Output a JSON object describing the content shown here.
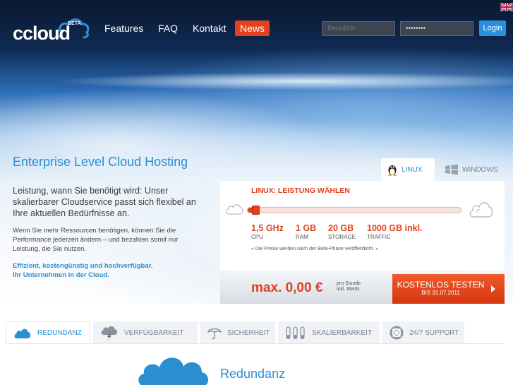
{
  "brand": {
    "logo_text": "ccloud",
    "logo_badge": "BETA"
  },
  "nav": {
    "items": [
      {
        "label": "Features"
      },
      {
        "label": "FAQ"
      },
      {
        "label": "Kontakt"
      },
      {
        "label": "News"
      }
    ]
  },
  "login": {
    "user_placeholder": "Benutzer",
    "password_value": "••••••••",
    "button_label": "Login"
  },
  "hero": {
    "title": "Enterprise Level Cloud Hosting",
    "lead": "Leistung, wann Sie benötigt wird: Unser skalierbarer Cloudservice passt sich flexibel an Ihre aktuellen Bedürfnisse an.",
    "body": "Wenn Sie mehr Ressourcen benötigen, können Sie die Performance jederzeit ändern – und bezahlen somit nur Leistung, die Sie nutzen.",
    "bold_line1": "Effizient, kostengünstig und hochverfügbar.",
    "bold_line2": "Ihr Unternehmen in der Cloud."
  },
  "os_tabs": [
    {
      "label": "LINUX",
      "selected": true
    },
    {
      "label": "WINDOWS",
      "selected": false
    }
  ],
  "config": {
    "title": "LINUX: LEISTUNG WÄHLEN",
    "slider_level_percent": 2,
    "specs": [
      {
        "value": "1,5 GHz",
        "label": "CPU"
      },
      {
        "value": "1 GB",
        "label": "RAM"
      },
      {
        "value": "20 GB",
        "label": "STORAGE"
      },
      {
        "value": "1000 GB inkl.",
        "label": "TRAFFIC"
      }
    ],
    "note": "« Die Preise werden nach der Beta-Phase veröffentlicht. »"
  },
  "price": {
    "value": "max. 0,00 €",
    "unit_line1": "pro Stunde",
    "unit_line2": "inkl. MwSt."
  },
  "cta": {
    "main": "KOSTENLOS TESTEN",
    "sub": "BIS 31.07.2011"
  },
  "feature_tabs": [
    {
      "label": "REDUNDANZ",
      "icon": "cloud-icon",
      "selected": true
    },
    {
      "label": "VERFÜGBARKEIT",
      "icon": "storm-cloud-icon",
      "selected": false
    },
    {
      "label": "SICHERHEIT",
      "icon": "umbrella-icon",
      "selected": false
    },
    {
      "label": "SKALIERBARKEIT",
      "icon": "thermometer-icon",
      "selected": false
    },
    {
      "label": "24/7 SUPPORT",
      "icon": "lifebuoy-icon",
      "selected": false
    }
  ],
  "feature": {
    "title": "Redundanz"
  },
  "colors": {
    "accent_blue": "#2a8ed1",
    "accent_orange": "#e2411c",
    "login_blue": "#2b8fe0"
  }
}
